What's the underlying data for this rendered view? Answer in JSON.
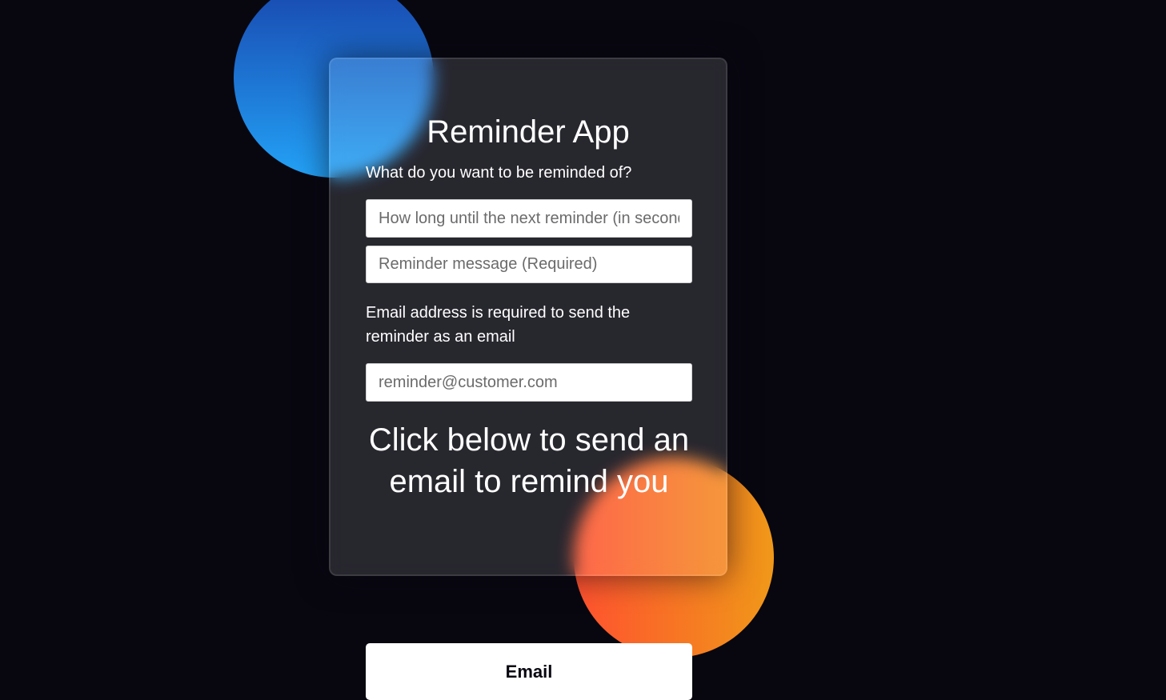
{
  "app": {
    "title": "Reminder App"
  },
  "form": {
    "prompt_label": "What do you want to be reminded of?",
    "seconds_input": {
      "value": "",
      "placeholder": "How long until the next reminder (in seconds)"
    },
    "message_input": {
      "value": "",
      "placeholder": "Reminder message (Required)"
    },
    "email_note": "Email address is required to send the reminder as an email",
    "email_input": {
      "value": "",
      "placeholder": "reminder@customer.com"
    },
    "cta_text": "Click below to send an email to remind you"
  },
  "actions": {
    "email_button_label": "Email"
  },
  "colors": {
    "background": "#080710",
    "blue_gradient": [
      "#1845ad",
      "#23a2f6"
    ],
    "orange_gradient": [
      "#ff512f",
      "#f09819"
    ],
    "button_background": "#ffffff"
  }
}
